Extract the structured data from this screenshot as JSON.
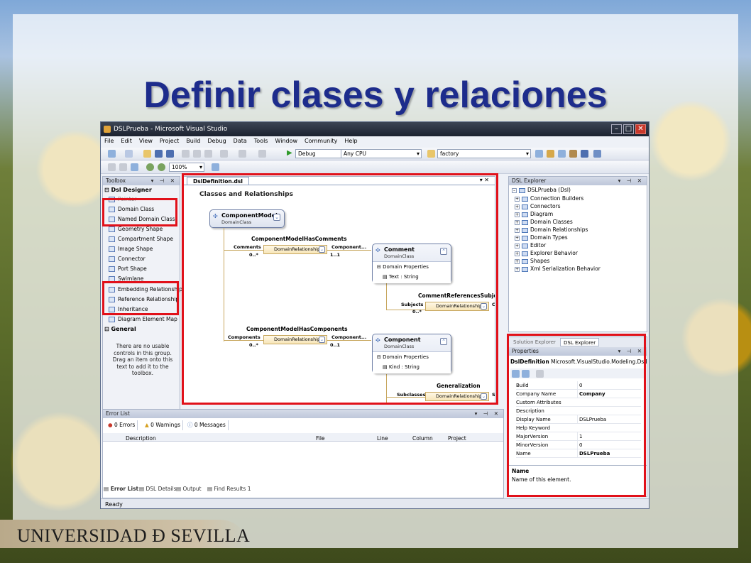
{
  "slide": {
    "title": "Definir clases y relaciones",
    "footer": "UNIVERSIDAD Ð SEVILLA"
  },
  "window": {
    "title": "DSLPrueba - Microsoft Visual Studio",
    "menu": [
      "File",
      "Edit",
      "View",
      "Project",
      "Build",
      "Debug",
      "Data",
      "Tools",
      "Window",
      "Community",
      "Help"
    ],
    "config_combo": "Debug",
    "platform_combo": "Any CPU",
    "find_combo": "factory",
    "zoom_combo": "100%",
    "status": "Ready"
  },
  "toolbox": {
    "header": "Toolbox",
    "group1": "Dsl Designer",
    "items": [
      "Pointer",
      "Domain Class",
      "Named Domain Class",
      "Geometry Shape",
      "Compartment Shape",
      "Image Shape",
      "Connector",
      "Port Shape",
      "Swimlane",
      "Embedding Relationship",
      "Reference Relationship",
      "Inheritance",
      "Diagram Element Map"
    ],
    "group2": "General",
    "general_note": "There are no usable controls in this group. Drag an item onto this text to add it to the toolbox."
  },
  "designer": {
    "tab": "DslDefinition.dsl",
    "canvas_title": "Classes and Relationships",
    "component_model": {
      "name": "ComponentModel",
      "kind": "DomainClass"
    },
    "comment": {
      "name": "Comment",
      "kind": "DomainClass",
      "section": "Domain Properties",
      "prop": "Text : String"
    },
    "component": {
      "name": "Component",
      "kind": "DomainClass",
      "section": "Domain Properties",
      "prop": "Kind : String"
    },
    "rel1": {
      "label": "ComponentModelHasComments",
      "box": "DomainRelationship",
      "src_role": "Comments",
      "src_mult": "0..*",
      "dst_role": "Component...",
      "dst_mult": "1..1"
    },
    "rel2": {
      "label": "CommentReferencesSubject",
      "box": "DomainRelationship",
      "src_role": "Subjects",
      "src_mult": "0..*",
      "dst_cut": "C"
    },
    "rel3": {
      "label": "ComponentModelHasComponents",
      "box": "DomainRelationship",
      "src_role": "Components",
      "src_mult": "0..*",
      "dst_role": "Component...",
      "dst_mult": "0..1"
    },
    "rel4": {
      "label": "Generalization",
      "box": "DomainRelationship",
      "src_role": "Subclasses",
      "dst_cut": "S"
    }
  },
  "explorer": {
    "header": "DSL Explorer",
    "root": "DSLPrueba (Dsl)",
    "items": [
      "Connection Builders",
      "Connectors",
      "Diagram",
      "Domain Classes",
      "Domain Relationships",
      "Domain Types",
      "Editor",
      "Explorer Behavior",
      "Shapes",
      "Xml Serialization Behavior"
    ]
  },
  "props": {
    "tab1": "Solution Explorer",
    "tab2": "DSL Explorer",
    "header": "Properties",
    "object": "DslDefinition",
    "object_type": "Microsoft.VisualStudio.Modeling.DslDe",
    "rows": [
      {
        "k": "Build",
        "v": "0"
      },
      {
        "k": "Company Name",
        "v": "Company"
      },
      {
        "k": "Custom Attributes",
        "v": ""
      },
      {
        "k": "Description",
        "v": ""
      },
      {
        "k": "Display Name",
        "v": "DSLPrueba"
      },
      {
        "k": "Help Keyword",
        "v": ""
      },
      {
        "k": "MajorVersion",
        "v": "1"
      },
      {
        "k": "MinorVersion",
        "v": "0"
      },
      {
        "k": "Name",
        "v": "DSLPrueba"
      }
    ],
    "desc_title": "Name",
    "desc_text": "Name of this element."
  },
  "errors": {
    "header": "Error List",
    "errors_btn": "0 Errors",
    "warnings_btn": "0 Warnings",
    "messages_btn": "0 Messages",
    "columns": [
      "Description",
      "File",
      "Line",
      "Column",
      "Project"
    ],
    "bottom_tabs": [
      "Error List",
      "DSL Details",
      "Output",
      "Find Results 1"
    ]
  }
}
